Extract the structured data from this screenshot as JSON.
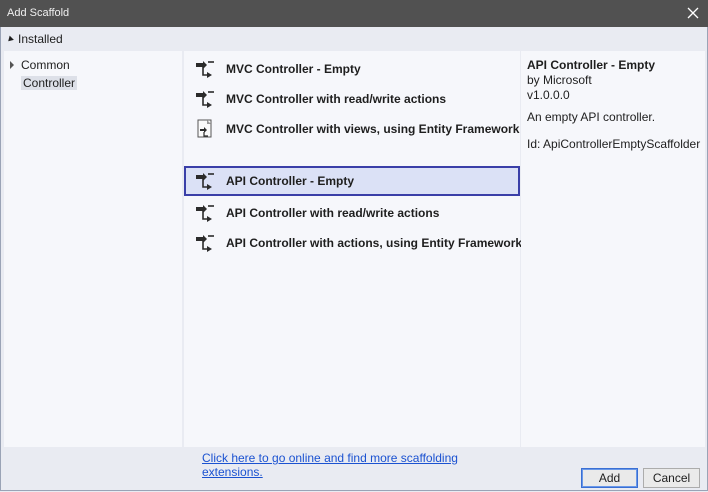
{
  "window": {
    "title": "Add Scaffold"
  },
  "installed_label": "Installed",
  "tree": [
    {
      "label": "Common",
      "expandable": true
    },
    {
      "label": "Controller",
      "selected": true
    }
  ],
  "scaffolds": [
    {
      "label": "MVC Controller - Empty",
      "icon": "controller-icon"
    },
    {
      "label": "MVC Controller with read/write actions",
      "icon": "controller-icon"
    },
    {
      "label": "MVC Controller with views, using Entity Framework",
      "icon": "view-controller-icon"
    },
    {
      "label": "API Controller - Empty",
      "icon": "controller-icon",
      "selected": true
    },
    {
      "label": "API Controller with read/write actions",
      "icon": "controller-icon"
    },
    {
      "label": "API Controller with actions, using Entity Framework",
      "icon": "controller-icon"
    }
  ],
  "online_link": "Click here to go online and find more scaffolding extensions.",
  "details": {
    "title": "API Controller - Empty",
    "author": "by Microsoft",
    "version": "v1.0.0.0",
    "description": "An empty API controller.",
    "id": "Id: ApiControllerEmptyScaffolder"
  },
  "buttons": {
    "add": "Add",
    "cancel": "Cancel"
  },
  "colors": {
    "selection_border": "#3a3fa8",
    "selection_fill": "#dbe1f6",
    "link": "#1b52d1",
    "titlebar": "#515151"
  }
}
